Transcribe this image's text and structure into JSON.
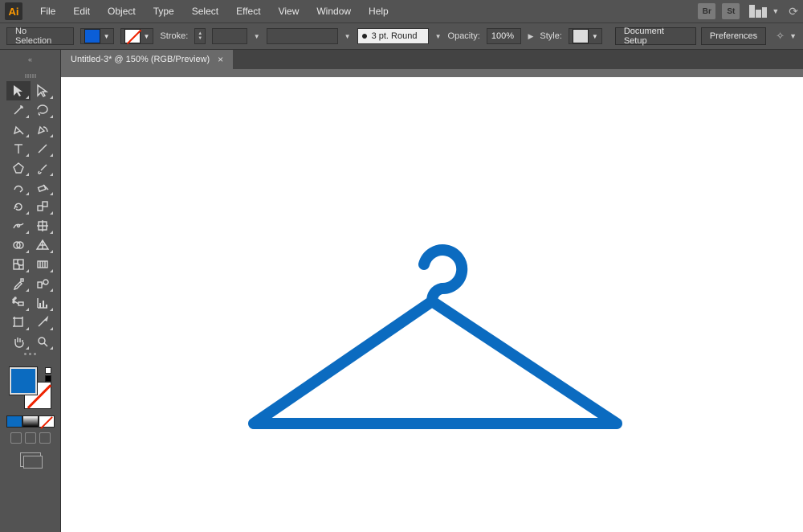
{
  "app": {
    "logo_text": "Ai"
  },
  "menu": {
    "items": [
      "File",
      "Edit",
      "Object",
      "Type",
      "Select",
      "Effect",
      "View",
      "Window",
      "Help"
    ],
    "top_icons": {
      "br": "Br",
      "st": "St"
    }
  },
  "options": {
    "selection_label": "No Selection",
    "stroke_label": "Stroke:",
    "stroke_weight_value": "",
    "brush_label": "3 pt. Round",
    "opacity_label": "Opacity:",
    "opacity_value": "100%",
    "style_label": "Style:",
    "doc_setup_label": "Document Setup",
    "preferences_label": "Preferences"
  },
  "tab": {
    "title": "Untitled-3* @ 150% (RGB/Preview)",
    "close_glyph": "×"
  },
  "colors": {
    "fill": "#0b6bc0",
    "artwork_stroke": "#0b6bc0"
  },
  "artwork": {
    "description": "coat-hanger vector shape",
    "stroke_px": 14
  }
}
